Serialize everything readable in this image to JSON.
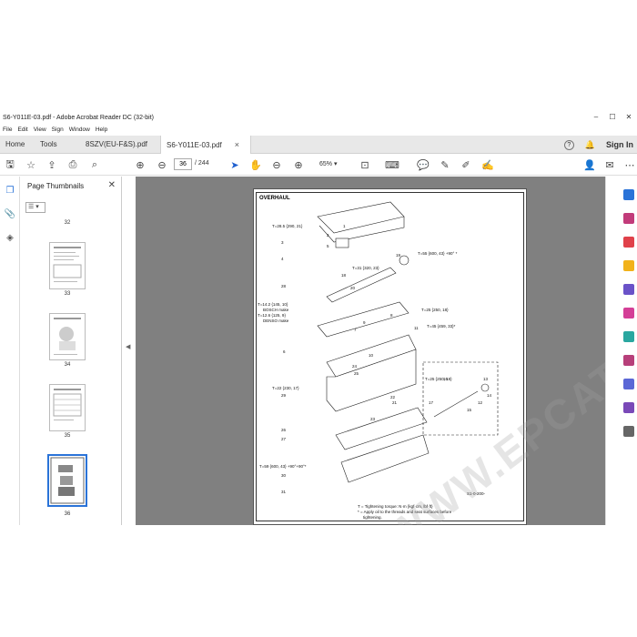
{
  "window": {
    "title": "S6-Y011E-03.pdf - Adobe Acrobat Reader DC (32-bit)"
  },
  "menu": [
    "File",
    "Edit",
    "View",
    "Sign",
    "Window",
    "Help"
  ],
  "tabs": {
    "home": "Home",
    "tools": "Tools",
    "doc1": "8SZV(EU-F&S).pdf",
    "doc2": "S6-Y011E-03.pdf"
  },
  "header": {
    "signin": "Sign In",
    "help": "?",
    "bell": "🔔"
  },
  "toolbar": {
    "page_current": "36",
    "page_sep": "/",
    "page_total": "244",
    "zoom": "65%"
  },
  "thumbs": {
    "title": "Page Thumbnails",
    "pages": [
      "32",
      "33",
      "34",
      "35",
      "36"
    ]
  },
  "doc": {
    "section": "OVERHAUL",
    "callouts": [
      "T=28.5 {290, 21}",
      "T=31 {320, 23}",
      "T=55 {600, 43} +90° *",
      "T=14.2 {145, 10}",
      "BOSCH make",
      "T=12.6 {125, 9}",
      "DENSO make",
      "T=25 {250, 18}",
      "T=45 {459, 33}*",
      "T=22 {230, 17}",
      "T=59 {600, 43} +90°+90°*",
      "T=25 {250, 18}"
    ],
    "numbers": [
      "1",
      "2",
      "3",
      "4",
      "5",
      "6",
      "7",
      "8",
      "9",
      "10",
      "11",
      "12",
      "13",
      "14",
      "15",
      "16",
      "17",
      "18",
      "19",
      "20",
      "21",
      "22",
      "23",
      "24",
      "25",
      "26",
      "27",
      "28",
      "29",
      "30",
      "31"
    ],
    "note1": "T = Tightening torque: N·m {kgf·cm, lbf·ft}",
    "note2": "* = Apply oil to the threads and seat surfaces before",
    "note3": "tightening.",
    "figcode": "S1-0-200-"
  },
  "watermark": "WWW.EPCATPO.COM",
  "colors": {
    "accent": "#2a73d8",
    "docbg": "#808080"
  }
}
